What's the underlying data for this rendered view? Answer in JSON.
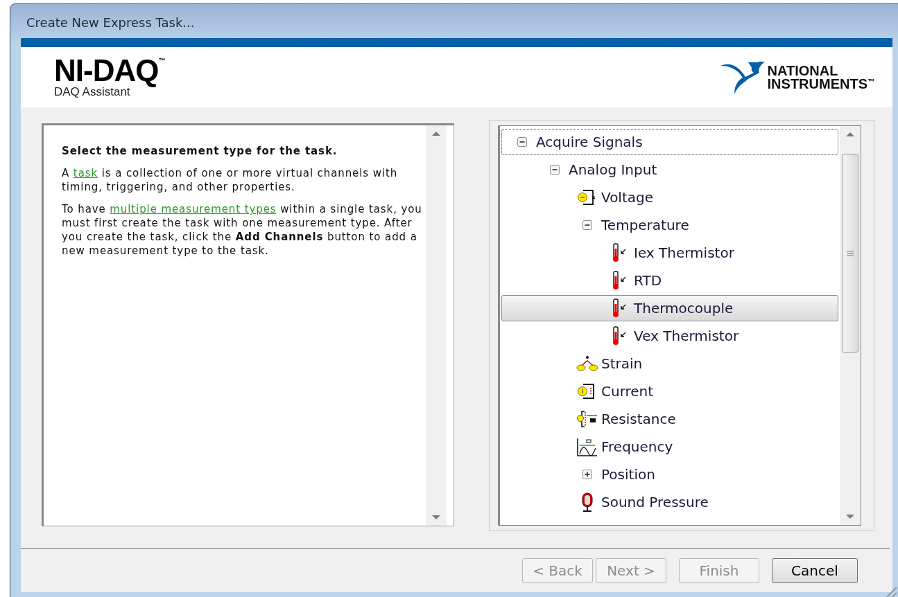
{
  "window": {
    "title": "Create New Express Task..."
  },
  "header": {
    "product": "NI-DAQ",
    "product_mark": "™",
    "subtitle": "DAQ Assistant",
    "brand_lines": [
      "NATIONAL",
      "INSTRUMENTS"
    ],
    "brand_mark": "™"
  },
  "help": {
    "heading": "Select the measurement type for the task.",
    "paragraphs": [
      [
        {
          "kind": "text",
          "text": "A "
        },
        {
          "kind": "link",
          "text": "task"
        },
        {
          "kind": "text",
          "text": " is a collection of one or more virtual channels with timing, triggering, and other properties."
        }
      ],
      [
        {
          "kind": "text",
          "text": "To have "
        },
        {
          "kind": "link",
          "text": "multiple measurement types"
        },
        {
          "kind": "text",
          "text": " within a single task, you must first create the task with one measurement type. After you create the task, click the **Add Channels** button to add a new measurement type to the task."
        }
      ]
    ]
  },
  "tree": [
    {
      "label": "Acquire Signals",
      "kind": "group",
      "expanded": true,
      "selected": false,
      "focused": true,
      "children": [
        {
          "label": "Analog Input",
          "kind": "group",
          "expanded": true,
          "selected": false,
          "focused": false,
          "children": [
            {
              "label": "Voltage",
              "kind": "voltage",
              "selected": false,
              "focused": false
            },
            {
              "label": "Temperature",
              "kind": "group",
              "expanded": true,
              "selected": false,
              "focused": false,
              "children": [
                {
                  "label": "Iex Thermistor",
                  "kind": "thermometer",
                  "selected": false,
                  "focused": false
                },
                {
                  "label": "RTD",
                  "kind": "thermometer",
                  "selected": false,
                  "focused": false
                },
                {
                  "label": "Thermocouple",
                  "kind": "thermometer",
                  "selected": true,
                  "focused": false
                },
                {
                  "label": "Vex Thermistor",
                  "kind": "thermometer",
                  "selected": false,
                  "focused": false
                }
              ]
            },
            {
              "label": "Strain",
              "kind": "strain",
              "selected": false,
              "focused": false
            },
            {
              "label": "Current",
              "kind": "current",
              "selected": false,
              "focused": false
            },
            {
              "label": "Resistance",
              "kind": "resistance",
              "selected": false,
              "focused": false
            },
            {
              "label": "Frequency",
              "kind": "frequency",
              "selected": false,
              "focused": false
            },
            {
              "label": "Position",
              "kind": "group",
              "expanded": false,
              "selected": false,
              "focused": false
            },
            {
              "label": "Sound Pressure",
              "kind": "microphone",
              "selected": false,
              "focused": false
            }
          ]
        }
      ]
    }
  ],
  "buttons": [
    {
      "label": "< Back",
      "disabled": true
    },
    {
      "label": "Next >",
      "disabled": true
    },
    {
      "label": "Finish",
      "disabled": true
    },
    {
      "label": "Cancel",
      "disabled": false
    }
  ]
}
